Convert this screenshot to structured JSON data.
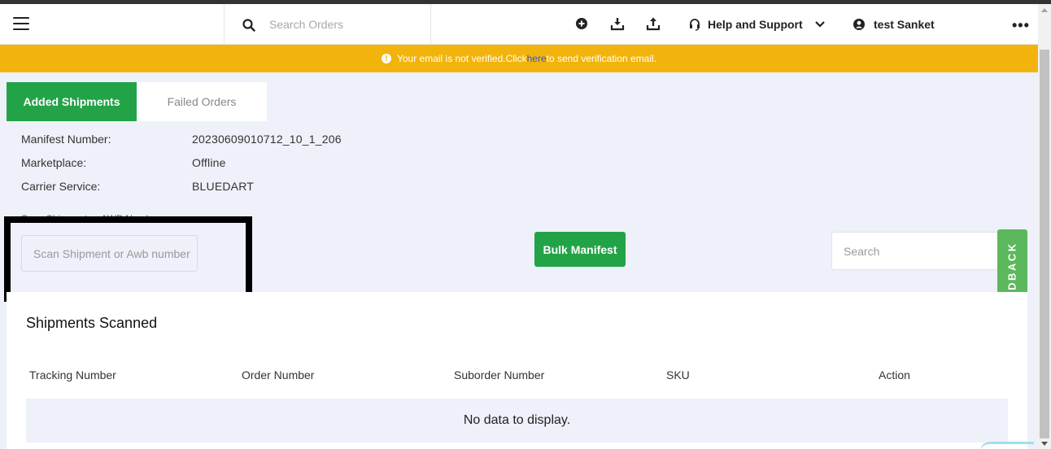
{
  "header": {
    "search_placeholder": "Search Orders",
    "icons": [
      "add-circle-icon",
      "download-icon",
      "upload-icon"
    ],
    "help_label": "Help and Support",
    "user_name": "test Sanket",
    "more_label": "•••"
  },
  "notice": {
    "text_before": "Your email is not verified.Click ",
    "link_text": "here",
    "text_after": " to send verification email."
  },
  "tabs": [
    {
      "label": "Added Shipments",
      "active": true
    },
    {
      "label": "Failed Orders",
      "active": false
    }
  ],
  "manifest": {
    "number_label": "Manifest Number:",
    "number_value": "20230609010712_10_1_206",
    "marketplace_label": "Marketplace:",
    "marketplace_value": "Offline",
    "carrier_label": "Carrier Service:",
    "carrier_value": "BLUEDART"
  },
  "scan": {
    "label": "Scan Shipment or AWB Number",
    "placeholder": "Scan Shipment or Awb number"
  },
  "bulk_manifest_label": "Bulk Manifest",
  "search_placeholder": "Search",
  "feedback_label": "FEEDBACK",
  "shipments": {
    "title": "Shipments Scanned",
    "columns": [
      "Tracking Number",
      "Order Number",
      "Suborder Number",
      "SKU",
      "Action"
    ],
    "empty_text": "No data to display."
  },
  "colors": {
    "accent_green": "#23a347",
    "notice_yellow": "#f2b40c",
    "feedback_green": "#5cb85c"
  }
}
